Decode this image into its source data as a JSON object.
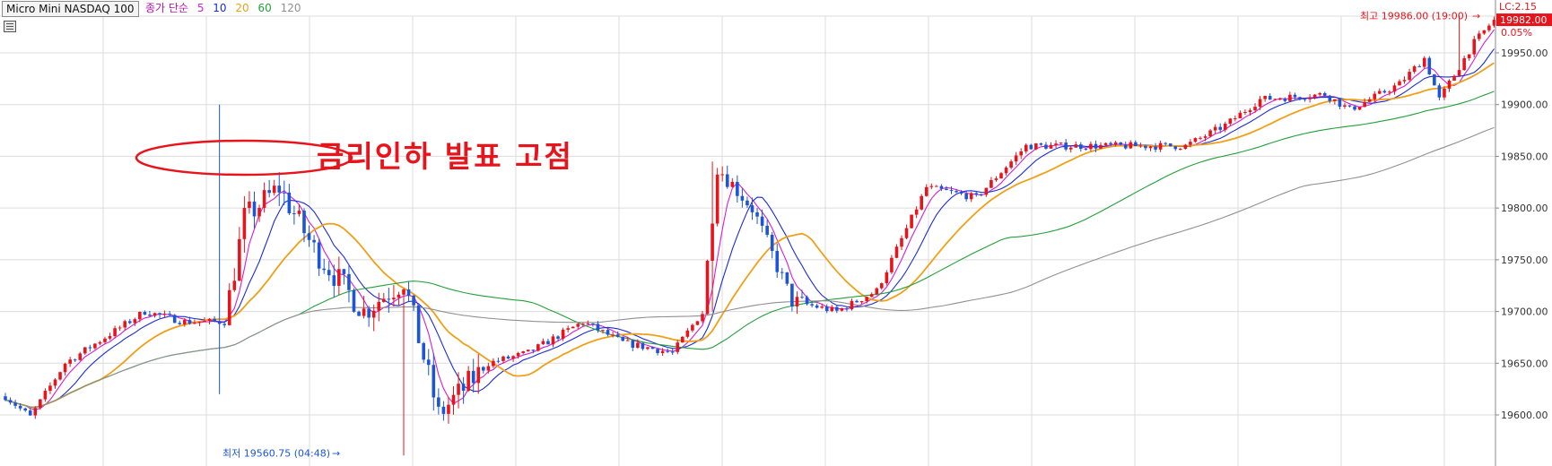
{
  "instrument": "Micro Mini NASDAQ 100",
  "legend": {
    "label": "종가 단순",
    "periods": [
      {
        "value": "5",
        "color": "#d21fd2"
      },
      {
        "value": "10",
        "color": "#1c2bd8"
      },
      {
        "value": "20",
        "color": "#f0a018"
      },
      {
        "value": "60",
        "color": "#22a03a"
      },
      {
        "value": "120",
        "color": "#909090"
      }
    ],
    "label_color": "#b01ab0"
  },
  "annotation": {
    "text": "금리인하 발표 고점",
    "color": "#e8141c"
  },
  "markers": {
    "high_label": "최고 19986.00 (19:00)",
    "low_label": "최저 19560.75 (04:48)",
    "lc_label": "LC:2.15",
    "last_price": "19982.00",
    "change_pct": "0.05%",
    "up_color": "#e8141c",
    "down_color": "#1c55d8"
  },
  "chart_data": {
    "type": "candlestick",
    "title": "Micro Mini NASDAQ 100",
    "y_axis": {
      "ticks": [
        "19950.00",
        "19900.00",
        "19850.00",
        "19800.00",
        "19750.00",
        "19700.00",
        "19650.00",
        "19600.00"
      ],
      "range": [
        19555,
        20005
      ],
      "side": "right"
    },
    "grid": true,
    "candle_count": 300,
    "key_points": [
      {
        "bar": 0,
        "price": 19618
      },
      {
        "bar": 5,
        "price": 19598
      },
      {
        "bar": 12,
        "price": 19650
      },
      {
        "bar": 20,
        "price": 19675
      },
      {
        "bar": 28,
        "price": 19700
      },
      {
        "bar": 36,
        "price": 19690
      },
      {
        "bar": 44,
        "price": 19690
      },
      {
        "bar": 48,
        "price": 19790
      },
      {
        "bar": 55,
        "price": 19820
      },
      {
        "bar": 62,
        "price": 19760
      },
      {
        "bar": 72,
        "price": 19700
      },
      {
        "bar": 80,
        "price": 19730
      },
      {
        "bar": 87,
        "price": 19600
      },
      {
        "bar": 97,
        "price": 19650
      },
      {
        "bar": 105,
        "price": 19660
      },
      {
        "bar": 116,
        "price": 19690
      },
      {
        "bar": 124,
        "price": 19670
      },
      {
        "bar": 134,
        "price": 19660
      },
      {
        "bar": 140,
        "price": 19700
      },
      {
        "bar": 143,
        "price": 19840
      },
      {
        "bar": 150,
        "price": 19800
      },
      {
        "bar": 158,
        "price": 19710
      },
      {
        "bar": 167,
        "price": 19700
      },
      {
        "bar": 175,
        "price": 19720
      },
      {
        "bar": 185,
        "price": 19820
      },
      {
        "bar": 195,
        "price": 19810
      },
      {
        "bar": 205,
        "price": 19860
      },
      {
        "bar": 220,
        "price": 19860
      },
      {
        "bar": 237,
        "price": 19860
      },
      {
        "bar": 245,
        "price": 19880
      },
      {
        "bar": 252,
        "price": 19905
      },
      {
        "bar": 265,
        "price": 19910
      },
      {
        "bar": 270,
        "price": 19895
      },
      {
        "bar": 280,
        "price": 19920
      },
      {
        "bar": 285,
        "price": 19945
      },
      {
        "bar": 288,
        "price": 19905
      },
      {
        "bar": 295,
        "price": 19960
      },
      {
        "bar": 299,
        "price": 19982
      }
    ],
    "extremes": [
      {
        "label": "high",
        "bar": 292,
        "price": 19986.0,
        "time": "19:00"
      },
      {
        "label": "low",
        "bar": 80,
        "price": 19560.75,
        "time": "04:48"
      }
    ],
    "spikes": [
      {
        "bar": 43,
        "high": 19900,
        "low": 19620
      },
      {
        "bar": 142,
        "high": 19845,
        "low": 19700
      }
    ],
    "moving_averages": [
      {
        "name": "5",
        "period": 5,
        "color": "#d21fd2"
      },
      {
        "name": "10",
        "period": 10,
        "color": "#1c2bd8"
      },
      {
        "name": "20",
        "period": 20,
        "color": "#f0a018"
      },
      {
        "name": "60",
        "period": 60,
        "color": "#22a03a"
      },
      {
        "name": "120",
        "period": 120,
        "color": "#909090"
      }
    ],
    "last_price": 19982.0,
    "change_pct": 0.05
  }
}
